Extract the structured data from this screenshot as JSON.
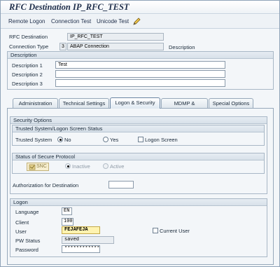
{
  "window": {
    "title": "RFC Destination IP_RFC_TEST"
  },
  "toolbar": {
    "remote_logon": "Remote Logon",
    "connection_test": "Connection Test",
    "unicode_test": "Unicode Test"
  },
  "header": {
    "rfc_destination_label": "RFC Destination",
    "rfc_destination_value": "IP_RFC_TEST",
    "connection_type_label": "Connection Type",
    "connection_type_code": "3",
    "connection_type_value": "ABAP Connection",
    "description_label": "Description"
  },
  "description": {
    "section_title": "Description",
    "desc1_label": "Description 1",
    "desc1_value": "Test",
    "desc2_label": "Description 2",
    "desc2_value": "",
    "desc3_label": "Description 3",
    "desc3_value": ""
  },
  "tabs": [
    {
      "label": "Administration"
    },
    {
      "label": "Technical Settings"
    },
    {
      "label": "Logon & Security"
    },
    {
      "label": "MDMP & Unicode"
    },
    {
      "label": "Special Options"
    }
  ],
  "active_tab": "Logon & Security",
  "security": {
    "section_title": "Security Options",
    "trusted_group_title": "Trusted System/Logon Screen Status",
    "trusted_system_label": "Trusted System",
    "trusted_no": "No",
    "trusted_yes": "Yes",
    "trusted_selected": "No",
    "logon_screen_label": "Logon Screen",
    "logon_screen_checked": false,
    "protocol_group_title": "Status of Secure Protocol",
    "snc_button": "SNC",
    "snc_inactive": "Inactive",
    "snc_active": "Active",
    "snc_selected": "Inactive",
    "auth_label": "Authorization for Destination",
    "auth_value": ""
  },
  "logon": {
    "section_title": "Logon",
    "language_label": "Language",
    "language_value": "EN",
    "client_label": "Client",
    "client_value": "100",
    "user_label": "User",
    "user_value": "FEJAFEJA",
    "current_user_label": "Current User",
    "current_user_checked": false,
    "pw_status_label": "PW Status",
    "pw_status_value": "saved",
    "password_label": "Password",
    "password_value": "************"
  },
  "colors": {
    "title_text": "#1f2e4a",
    "panel_bg": "#f3f6f9",
    "user_field_bg": "#fff3b0",
    "frame_border": "#8fa3b8"
  }
}
